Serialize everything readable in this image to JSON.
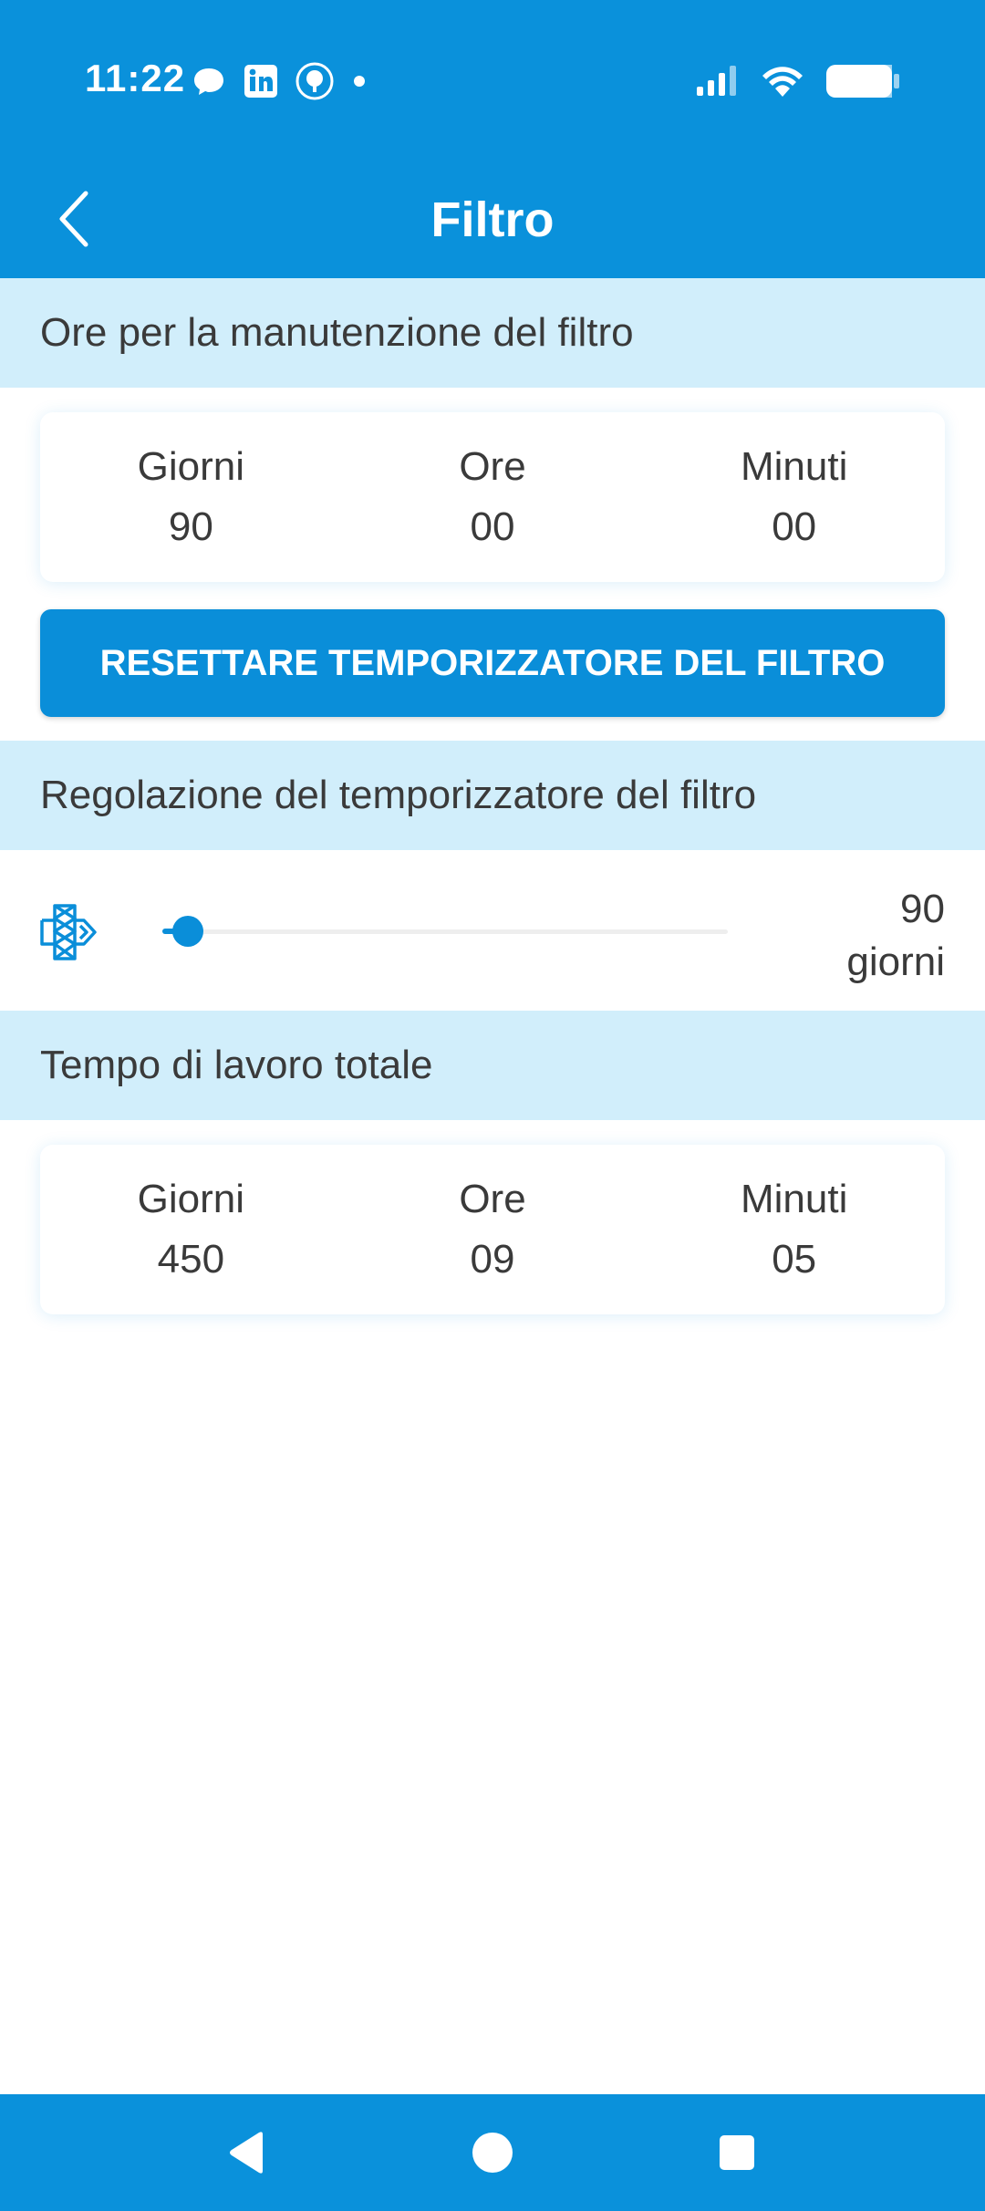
{
  "status_bar": {
    "time": "11:22",
    "left_icons": [
      "chat-bubble-icon",
      "linkedin-icon",
      "tree-badge-icon",
      "dot-icon"
    ],
    "right_icons": [
      "signal-icon",
      "wifi-icon",
      "battery-icon"
    ]
  },
  "app_bar": {
    "title": "Filtro",
    "back_icon": "chevron-left-icon"
  },
  "maintenance": {
    "header": "Ore per la manutenzione del filtro",
    "columns": [
      {
        "label": "Giorni",
        "value": "90"
      },
      {
        "label": "Ore",
        "value": "00"
      },
      {
        "label": "Minuti",
        "value": "00"
      }
    ],
    "reset_button": "RESETTARE TEMPORIZZATORE DEL FILTRO"
  },
  "timer_adjust": {
    "header": "Regolazione del temporizzatore del filtro",
    "icon": "filter-icon",
    "slider_fraction": 0.045,
    "value": "90",
    "unit": "giorni"
  },
  "total_work": {
    "header": "Tempo di lavoro totale",
    "columns": [
      {
        "label": "Giorni",
        "value": "450"
      },
      {
        "label": "Ore",
        "value": "09"
      },
      {
        "label": "Minuti",
        "value": "05"
      }
    ]
  },
  "nav_bar": {
    "buttons": [
      "back-triangle-icon",
      "home-circle-icon",
      "recents-square-icon"
    ]
  },
  "colors": {
    "primary": "#0A91DB",
    "section_bg": "#D1EEFB",
    "text": "#3a3a3a"
  }
}
